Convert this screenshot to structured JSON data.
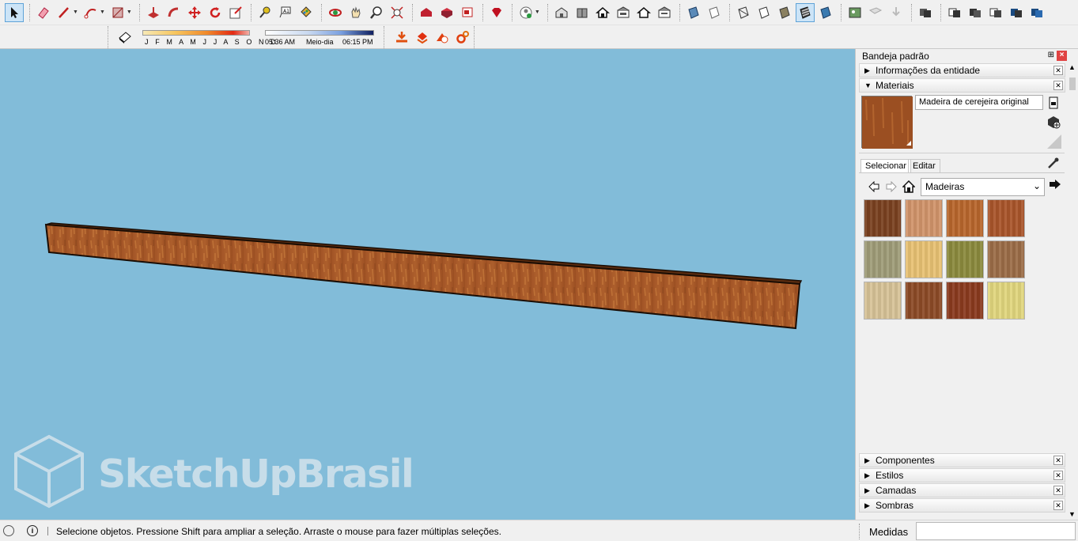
{
  "toolbar": {
    "icons": [
      "select-icon",
      "eraser-icon",
      "line-icon",
      "arc-icon",
      "rectangle-icon",
      "push-pull-icon",
      "follow-me-icon",
      "move-icon",
      "rotate-icon",
      "scale-icon",
      "tape-measure-icon",
      "text-icon",
      "paint-bucket-icon",
      "orbit-icon",
      "pan-icon",
      "zoom-icon",
      "zoom-extents-icon",
      "warehouse-icon",
      "extension-warehouse-icon",
      "layout-icon",
      "ruby-icon",
      "account-icon",
      "iso-view-icon",
      "top-view-icon",
      "front-view-icon",
      "right-view-icon",
      "back-view-icon",
      "left-view-icon",
      "xray-icon",
      "backedges-icon",
      "wireframe-icon",
      "hidden-line-icon",
      "shaded-icon",
      "shaded-texture-icon",
      "monochrome-icon",
      "photo-match-icon",
      "add-location-icon",
      "terrain-icon",
      "solid-union-icon",
      "solid-subtract-icon",
      "solid-trim-icon",
      "solid-intersect-icon",
      "solid-split-icon"
    ]
  },
  "shadows": {
    "months": "J F M A M J J A S O N D",
    "time_start": "05:36 AM",
    "time_mid": "Meio-dia",
    "time_end": "06:15 PM"
  },
  "tray": {
    "title": "Bandeja padrão",
    "pin": "⊞",
    "close": "×",
    "entity_info": "Informações da entidade",
    "materials": "Materiais",
    "material_name": "Madeira de cerejeira original",
    "tab_select": "Selecionar",
    "tab_edit": "Editar",
    "library": "Madeiras",
    "swatches": [
      "#7a4120",
      "#d1946a",
      "#b8662c",
      "#a9552a",
      "#9f9c78",
      "#e8c173",
      "#8b8a3d",
      "#9b6c47",
      "#d7c297",
      "#8c4a26",
      "#8a3a1e",
      "#e1d67d"
    ],
    "bottom_panels": [
      "Componentes",
      "Estilos",
      "Camadas",
      "Sombras"
    ]
  },
  "viewport": {
    "watermark": "SketchUpBrasil",
    "beam_color": "#a45828"
  },
  "status": {
    "message": "Selecione objetos. Pressione Shift para ampliar a seleção. Arraste o mouse para fazer múltiplas seleções.",
    "measurements_label": "Medidas",
    "info_glyph": "i"
  }
}
